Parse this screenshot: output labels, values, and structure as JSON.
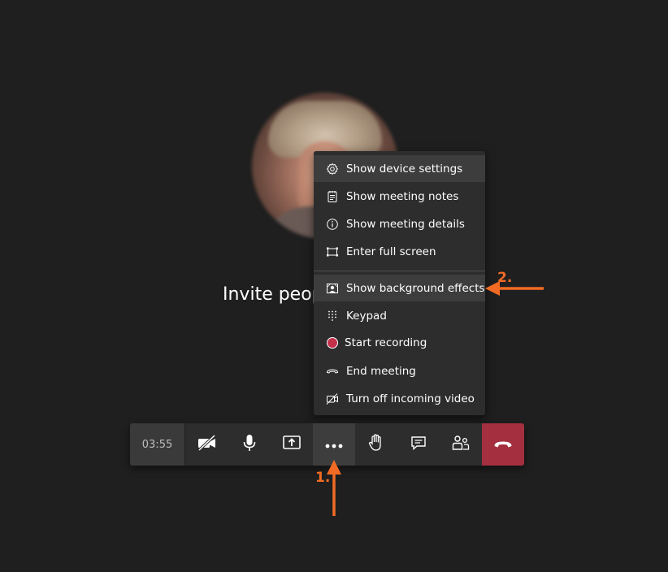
{
  "stage": {
    "invite_text": "Invite peop"
  },
  "menu": {
    "items": [
      {
        "label": "Show device settings",
        "icon": "gear-icon"
      },
      {
        "label": "Show meeting notes",
        "icon": "notes-icon"
      },
      {
        "label": "Show meeting details",
        "icon": "info-icon"
      },
      {
        "label": "Enter full screen",
        "icon": "fullscreen-icon"
      },
      {
        "label": "Show background effects",
        "icon": "background-effects-icon"
      },
      {
        "label": "Keypad",
        "icon": "keypad-icon"
      },
      {
        "label": "Start recording",
        "icon": "record-icon"
      },
      {
        "label": "End meeting",
        "icon": "end-call-icon"
      },
      {
        "label": "Turn off incoming video",
        "icon": "video-off-icon"
      }
    ]
  },
  "toolbar": {
    "timer": "03:55",
    "buttons": [
      {
        "name": "camera-off",
        "icon": "camera-off-icon"
      },
      {
        "name": "microphone",
        "icon": "microphone-icon"
      },
      {
        "name": "share-screen",
        "icon": "share-screen-icon"
      },
      {
        "name": "more-actions",
        "icon": "more-icon"
      },
      {
        "name": "raise-hand",
        "icon": "hand-icon"
      },
      {
        "name": "chat",
        "icon": "chat-icon"
      },
      {
        "name": "participants",
        "icon": "people-icon"
      },
      {
        "name": "hang-up",
        "icon": "hangup-icon"
      }
    ],
    "hangup_color": "#a4303f"
  },
  "annotations": {
    "step1": "1.",
    "step2": "2.",
    "color": "#f26b24"
  },
  "colors": {
    "background": "#1f1f1f",
    "menu_bg": "#2d2d2d",
    "menu_highlight": "#3d3d3d",
    "record_dot": "#c4314b"
  }
}
